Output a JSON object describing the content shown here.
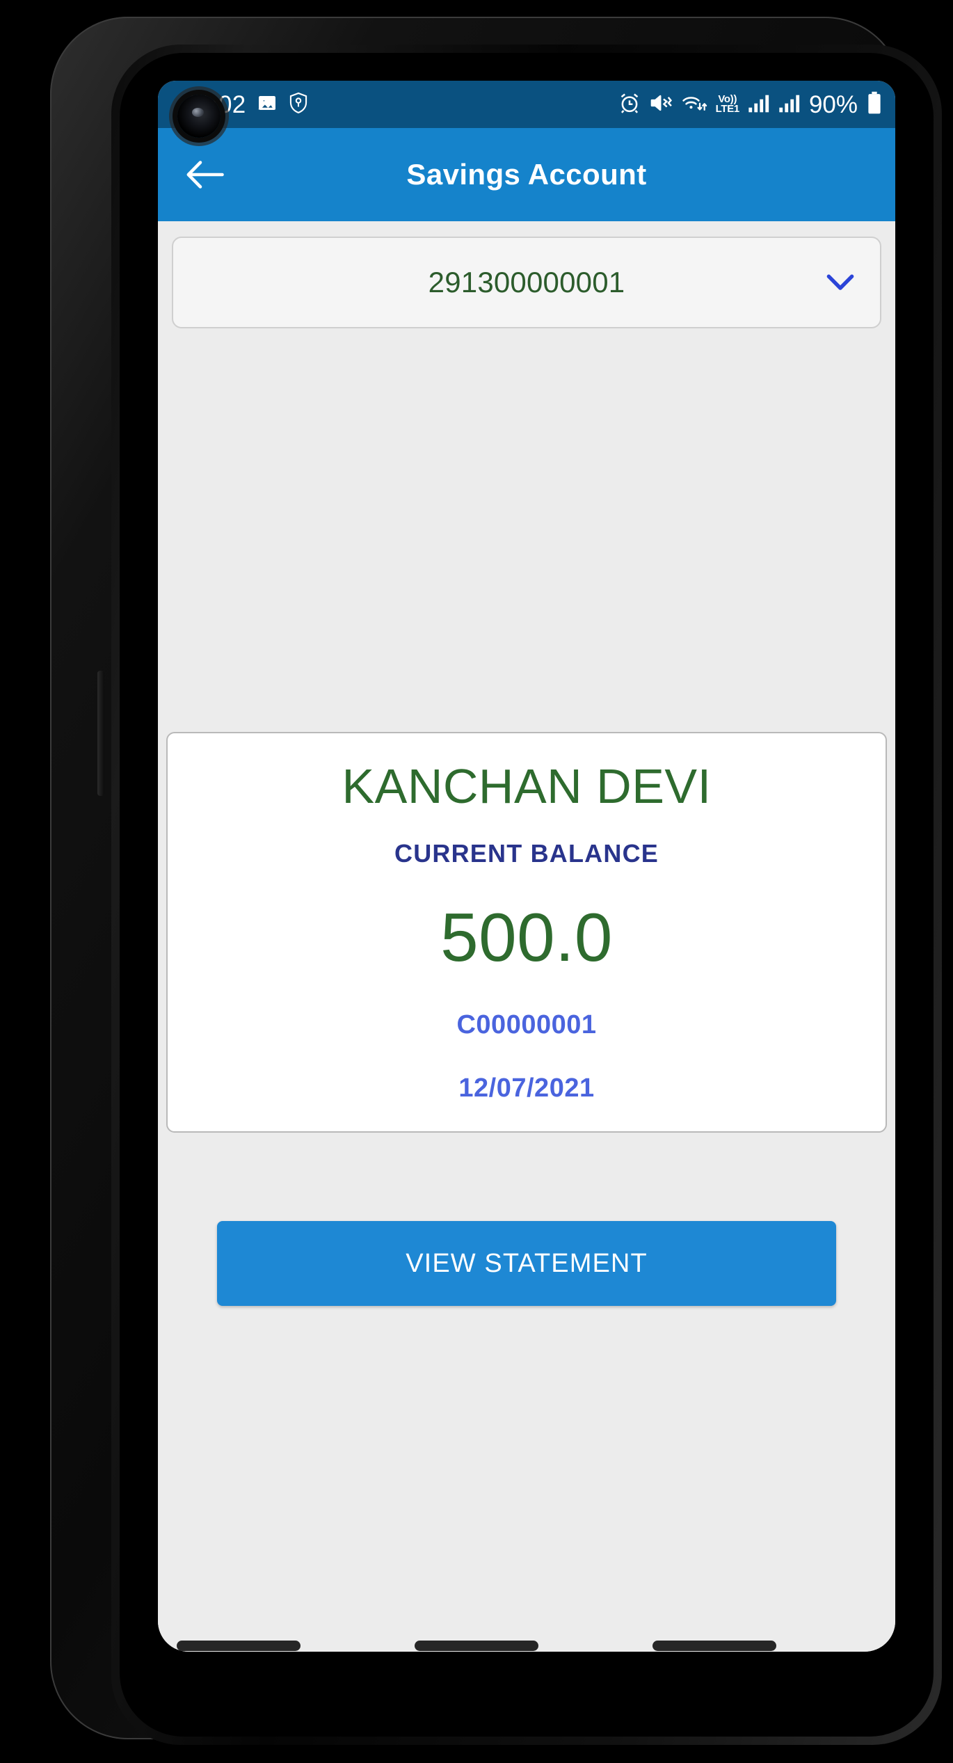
{
  "status_bar": {
    "time": "11:02",
    "left_icons": [
      "image-icon",
      "shield-key-icon"
    ],
    "right_icons": [
      "alarm-icon",
      "vibrate-mute-icon",
      "wifi-icon",
      "signal-icon-1",
      "signal-icon-2",
      "battery-icon"
    ],
    "network_label": "Vo))",
    "network_label_2": "LTE1",
    "battery_percent": "90%",
    "background_color": "#0A5180"
  },
  "app_bar": {
    "title": "Savings Account",
    "back_icon": "arrow-left-icon",
    "background_color": "#1583CB"
  },
  "account_selector": {
    "selected_account": "291300000001",
    "chevron_icon": "chevron-down-icon",
    "text_color": "#2C5C2C",
    "chevron_color": "#2B44D8"
  },
  "balance_card": {
    "account_holder": "KANCHAN DEVI",
    "balance_label": "CURRENT BALANCE",
    "balance_amount": "500.0",
    "customer_id": "C00000001",
    "date": "12/07/2021",
    "name_color": "#2E6B2E",
    "label_color": "#29348C",
    "amount_color": "#2E6B2E",
    "detail_color": "#4A64DE"
  },
  "actions": {
    "view_statement_label": "VIEW STATEMENT",
    "button_color": "#1E88D4"
  },
  "theme": {
    "body_background": "#ECECEC",
    "card_background": "#FFFFFF"
  }
}
